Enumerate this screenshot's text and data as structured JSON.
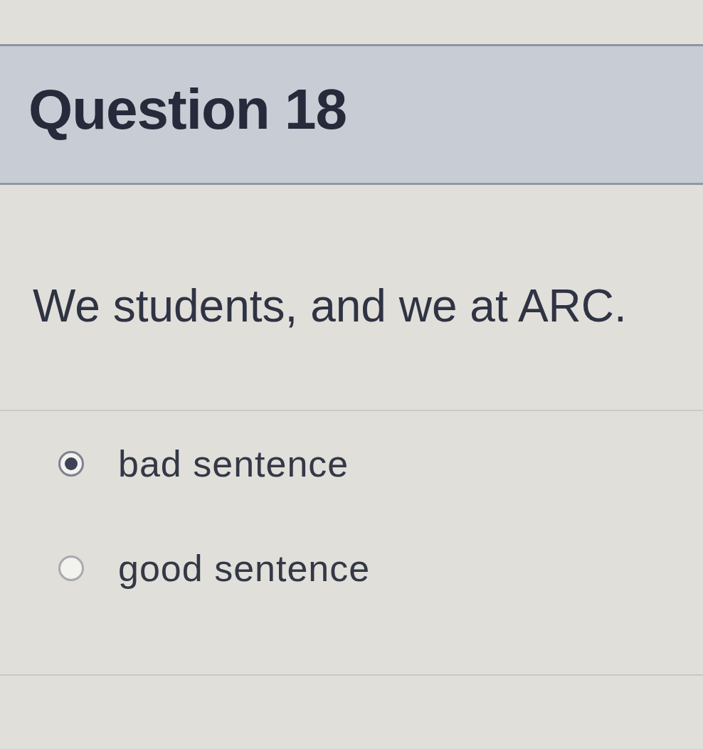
{
  "question": {
    "title": "Question 18",
    "text": "We students, and we at ARC."
  },
  "answers": [
    {
      "label": "bad sentence",
      "selected": true
    },
    {
      "label": "good sentence",
      "selected": false
    }
  ]
}
